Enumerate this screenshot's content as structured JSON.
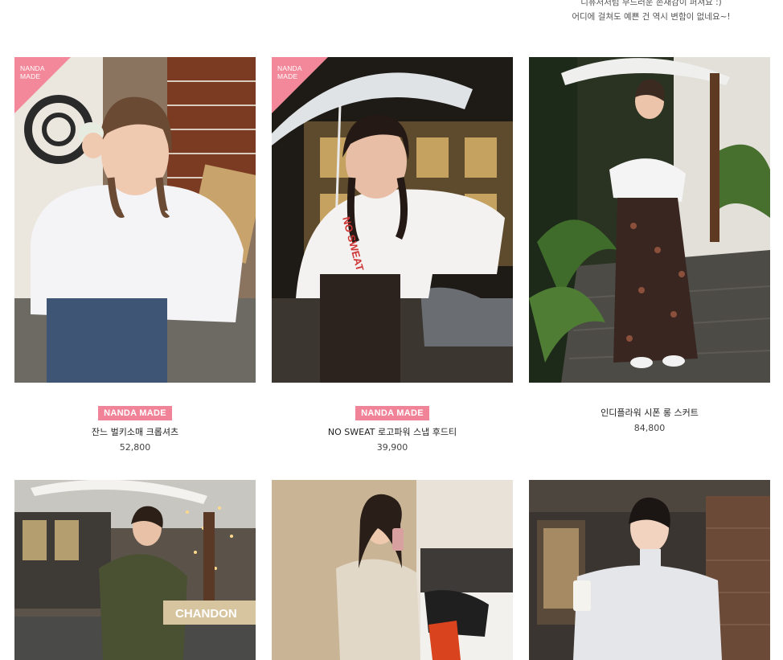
{
  "top_description": {
    "line1": "디퓨저처럼 부드러운 존재감이 퍼져요 :)",
    "line2": "어디에 걸쳐도 예쁜 건 역시 변함이 없네요~!"
  },
  "ribbon_text": {
    "line1": "NANDA",
    "line2": "MADE"
  },
  "colors": {
    "badge": "#f08398",
    "ribbon": "#f2889a"
  },
  "products": [
    {
      "badge": "NANDA MADE",
      "name": "잔느 벌키소매 크롭셔츠",
      "price": "52,800"
    },
    {
      "badge": "NANDA MADE",
      "name": "NO SWEAT 로고파워 스냅 후드티",
      "price": "39,900"
    },
    {
      "badge": "",
      "name": "인디플라워 시폰 롱 스커트",
      "price": "84,800"
    }
  ],
  "photo_text": {
    "hoodie_print": "NO SWEAT",
    "sign": "CHANDON"
  }
}
